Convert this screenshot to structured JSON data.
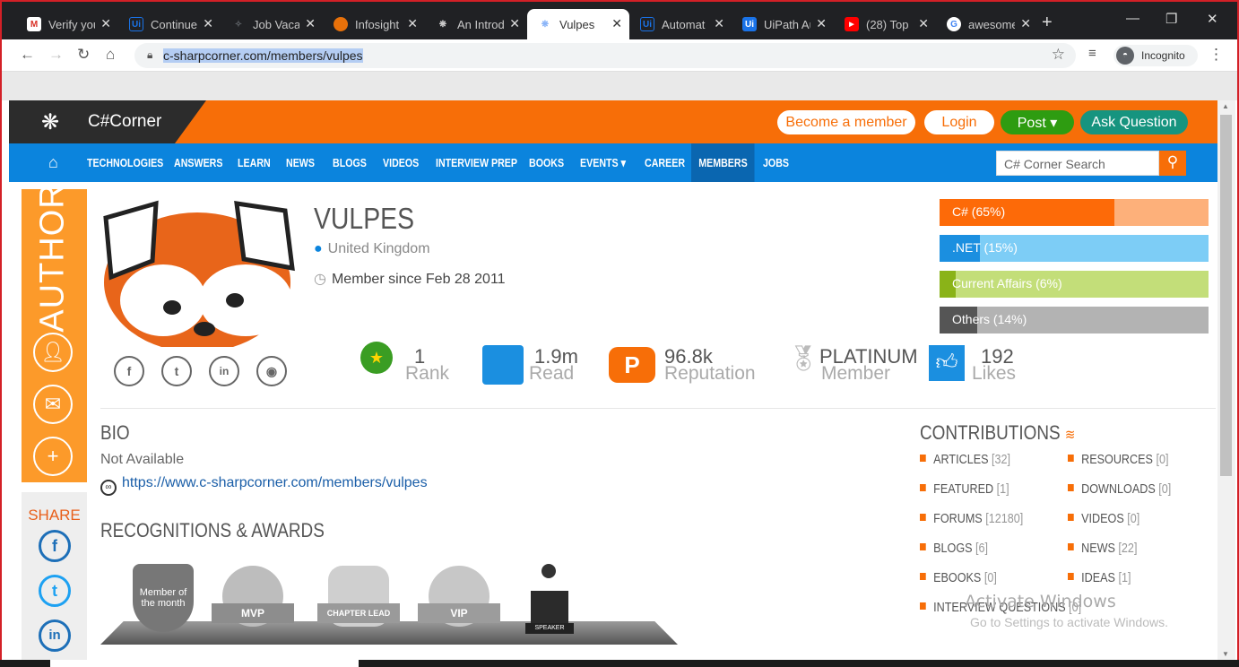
{
  "browser": {
    "tabs": [
      {
        "title": "Verify your",
        "icon": "gmail-icon",
        "color": "#d93025"
      },
      {
        "title": "Continue",
        "icon": "uipath-icon",
        "color": "#1a73e8"
      },
      {
        "title": "Job Vacan",
        "icon": "star-sparkle-icon",
        "color": "#5f6368"
      },
      {
        "title": "Infosight",
        "icon": "globe-icon",
        "color": "#e8710a"
      },
      {
        "title": "An Introd",
        "icon": "csharp-corner-icon",
        "color": "#8ab4f8"
      },
      {
        "title": "Vulpes",
        "icon": "csharp-corner-icon",
        "color": "#8ab4f8",
        "active": true
      },
      {
        "title": "Automat",
        "icon": "uipath-icon",
        "color": "#1a73e8"
      },
      {
        "title": "UiPath Au",
        "icon": "uipath-icon",
        "color": "#1a73e8"
      },
      {
        "title": "(28) Top",
        "icon": "youtube-icon",
        "color": "#ff0000"
      },
      {
        "title": "awesome",
        "icon": "google-icon",
        "color": "#4285f4"
      }
    ],
    "url": "c-sharpcorner.com/members/vulpes",
    "profile_label": "Incognito"
  },
  "site": {
    "logo_text": "C#Corner",
    "buttons": {
      "become_member": "Become a member",
      "login": "Login",
      "post": "Post ▾",
      "ask": "Ask Question"
    },
    "nav": [
      "TECHNOLOGIES",
      "ANSWERS",
      "LEARN",
      "NEWS",
      "BLOGS",
      "VIDEOS",
      "INTERVIEW PREP",
      "BOOKS",
      "EVENTS ▾",
      "CAREER",
      "MEMBERS",
      "JOBS"
    ],
    "nav_active": "MEMBERS",
    "search_placeholder": "C# Corner Search"
  },
  "sidebar": {
    "author_label": "AUTHOR",
    "share_label": "SHARE"
  },
  "profile": {
    "name": "VULPES",
    "location": "United Kingdom",
    "member_since": "Member since Feb 28 2011",
    "stats": [
      {
        "value": "1",
        "label": "Rank"
      },
      {
        "value": "1.9m",
        "label": "Read"
      },
      {
        "value": "96.8k",
        "label": "Reputation"
      },
      {
        "value": "PLATINUM",
        "label": "Member"
      },
      {
        "value": "192",
        "label": "Likes"
      }
    ],
    "skills": [
      {
        "label": "C# (65%)",
        "percent": 65,
        "color": "#fd6a08",
        "bg": "#fdb07a"
      },
      {
        "label": ".NET (15%)",
        "percent": 15,
        "color": "#1b8fe0",
        "bg": "#7dcdf6"
      },
      {
        "label": "Current Affairs (6%)",
        "percent": 6,
        "color": "#8ab318",
        "bg": "#c3de79"
      },
      {
        "label": "Others (14%)",
        "percent": 14,
        "color": "#555555",
        "bg": "#b3b3b3"
      }
    ]
  },
  "bio": {
    "title": "BIO",
    "text": "Not Available",
    "url": "https://www.c-sharpcorner.com/members/vulpes"
  },
  "recognitions": {
    "title": "RECOGNITIONS & AWARDS",
    "badges": [
      "Member of the month",
      "MVP",
      "CHAPTER LEAD",
      "VIP",
      "SPEAKER"
    ]
  },
  "contributions": {
    "title": "CONTRIBUTIONS",
    "left": [
      {
        "label": "ARTICLES",
        "count": "[32]"
      },
      {
        "label": "FEATURED",
        "count": "[1]"
      },
      {
        "label": "FORUMS",
        "count": "[12180]"
      },
      {
        "label": "BLOGS",
        "count": "[6]"
      },
      {
        "label": "EBOOKS",
        "count": "[0]"
      },
      {
        "label": "INTERVIEW QUESTIONS",
        "count": "[0]"
      }
    ],
    "right": [
      {
        "label": "RESOURCES",
        "count": "[0]"
      },
      {
        "label": "DOWNLOADS",
        "count": "[0]"
      },
      {
        "label": "VIDEOS",
        "count": "[0]"
      },
      {
        "label": "NEWS",
        "count": "[22]"
      },
      {
        "label": "IDEAS",
        "count": "[1]"
      }
    ]
  },
  "watermark": {
    "line1": "Activate Windows",
    "line2": "Go to Settings to activate Windows."
  }
}
